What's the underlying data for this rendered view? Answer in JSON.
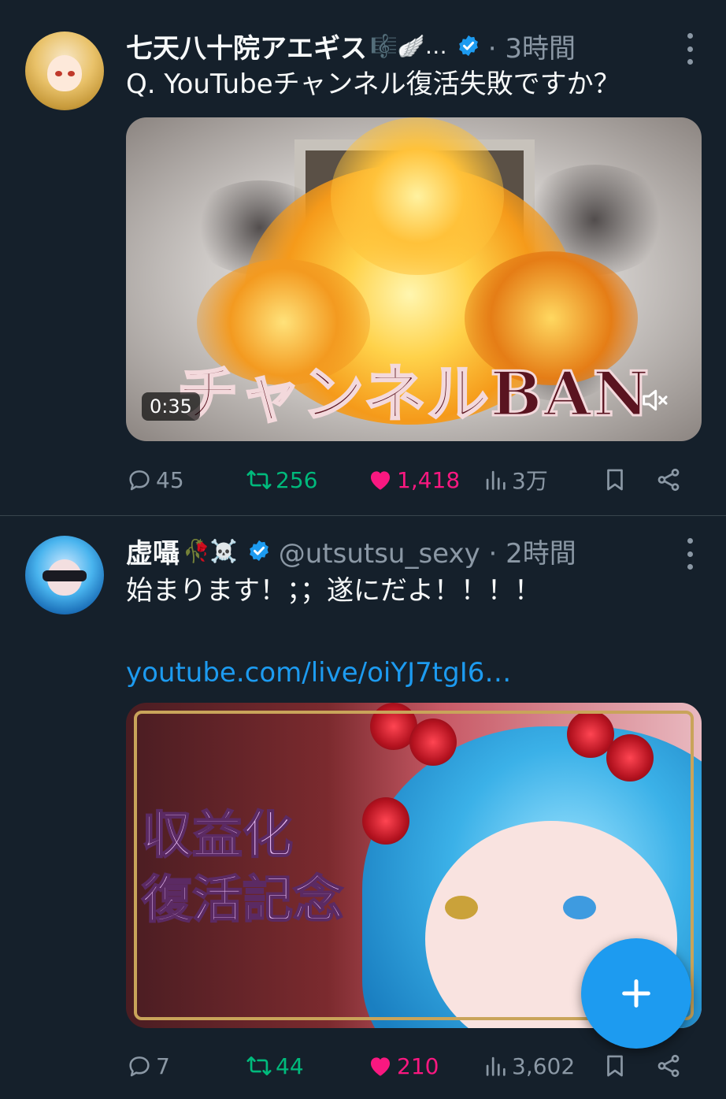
{
  "tweets": [
    {
      "name": "七天八十院アエギス",
      "name_emoji": "🎼🪽…",
      "handle": "· 3時間",
      "text": "Q. YouTubeチャンネル復活失敗ですか？",
      "media": {
        "type": "video",
        "duration": "0:35",
        "overlay_title": "チャンネルBAN"
      },
      "actions": {
        "replies": "45",
        "retweets": "256",
        "likes": "1,418",
        "views": "3万"
      }
    },
    {
      "name": "虚囁",
      "name_emoji": "🥀☠️",
      "handle": "@utsutsu_sexy · 2時間",
      "text": "始まります！；；遂にだよ！！！！",
      "link": "youtube.com/live/oiYJ7tgI6…",
      "media": {
        "type": "image",
        "overlay_title_line1": "収益化",
        "overlay_title_line2": "復活記念"
      },
      "actions": {
        "replies": "7",
        "retweets": "44",
        "likes": "210",
        "views": "3,602"
      }
    }
  ],
  "colors": {
    "background": "#15202b",
    "accent": "#1d9bf0",
    "retweet": "#00ba7c",
    "like": "#f91880",
    "muted": "#8b98a5"
  },
  "icons": [
    "more-icon",
    "verified-icon",
    "mute-icon",
    "reply-icon",
    "retweet-icon",
    "heart-icon",
    "views-icon",
    "bookmark-icon",
    "share-icon",
    "plus-icon"
  ]
}
